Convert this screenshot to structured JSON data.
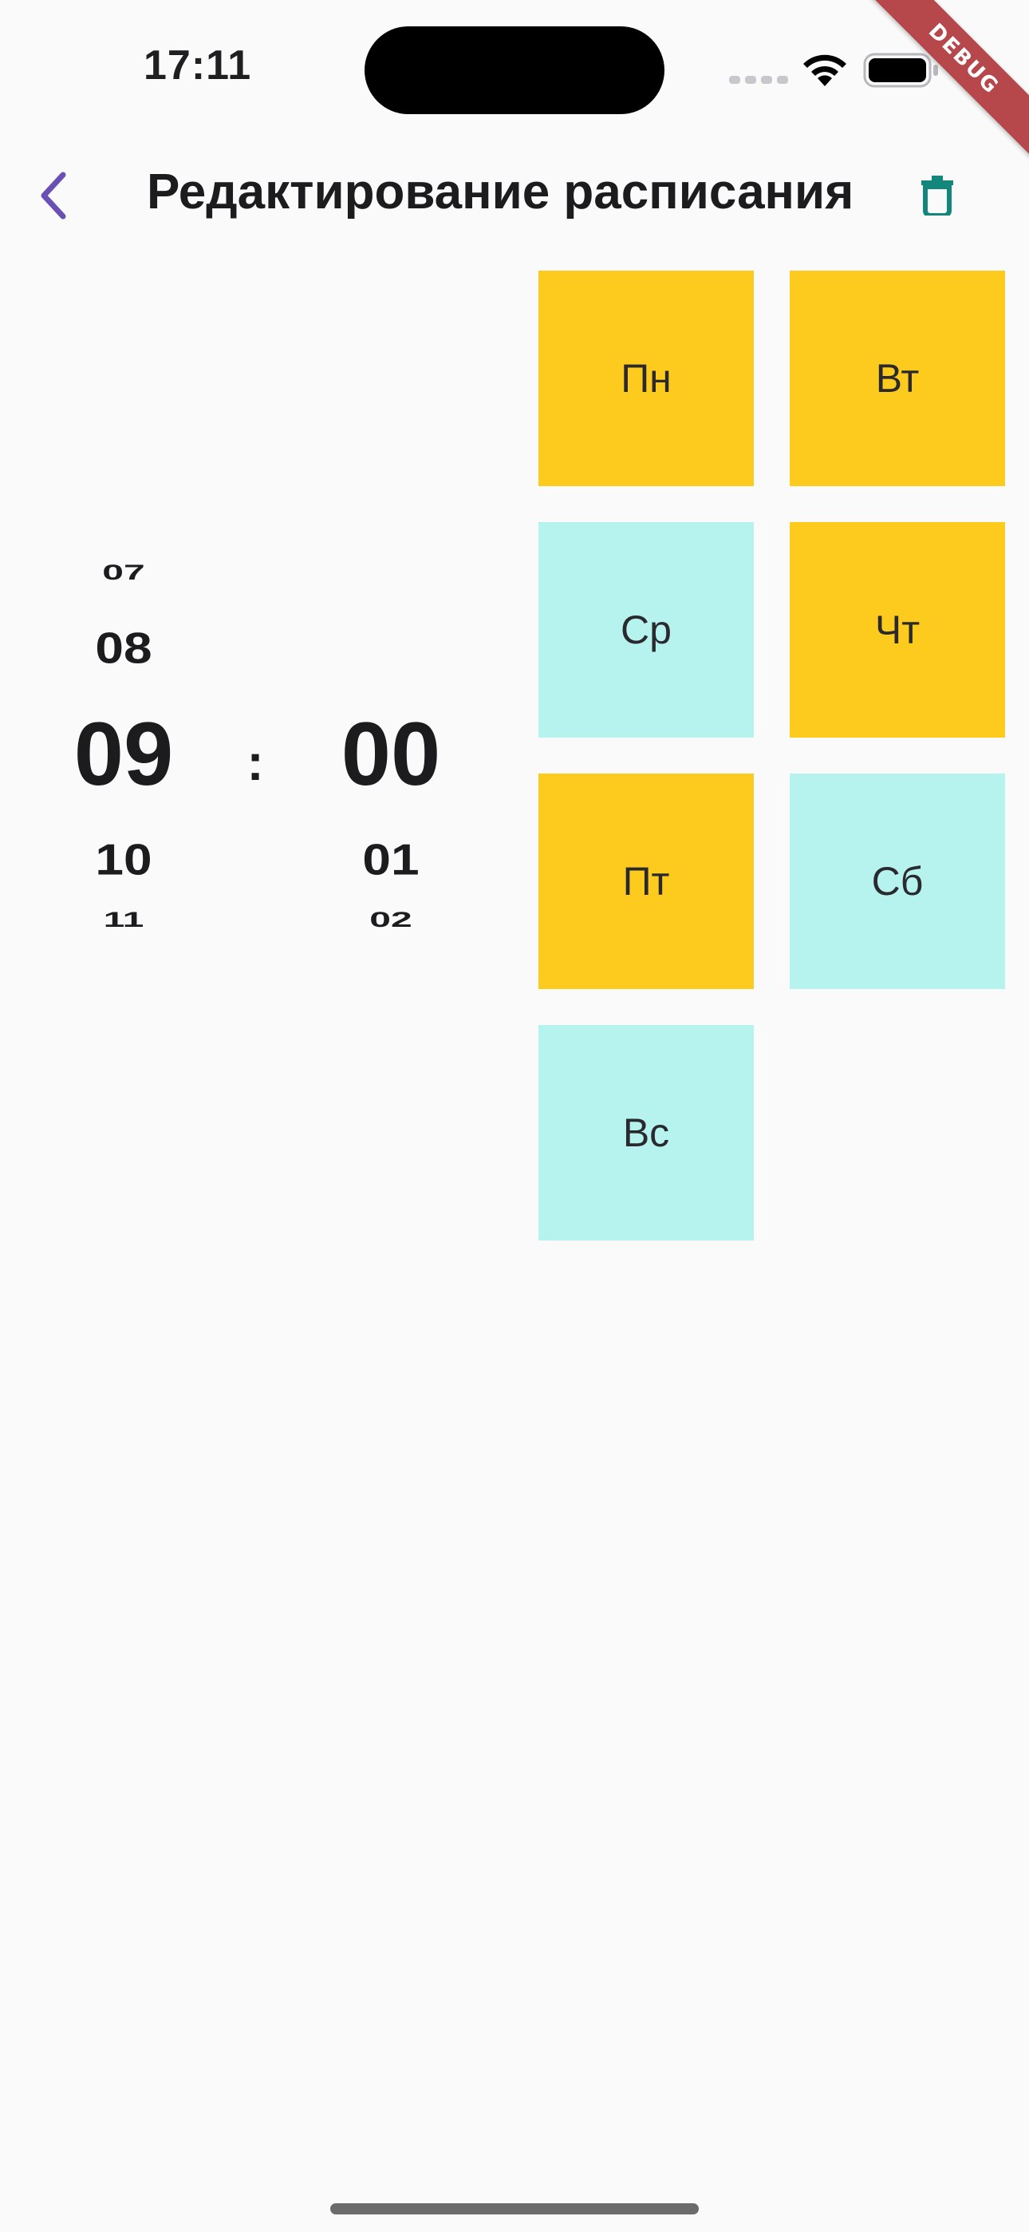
{
  "status_bar": {
    "time": "17:11"
  },
  "debug_banner": "DEBUG",
  "app_bar": {
    "title": "Редактирование расписания",
    "back_icon": "chevron-left-icon",
    "delete_icon": "trash-icon"
  },
  "time_picker": {
    "hours": [
      "07",
      "08",
      "09",
      "10",
      "11"
    ],
    "selected_hour": "09",
    "separator": ":",
    "minutes": [
      "",
      "",
      "00",
      "01",
      "02"
    ],
    "selected_minute": "00"
  },
  "days": [
    {
      "label": "Пн",
      "selected": true
    },
    {
      "label": "Вт",
      "selected": true
    },
    {
      "label": "Ср",
      "selected": false
    },
    {
      "label": "Чт",
      "selected": true
    },
    {
      "label": "Пт",
      "selected": true
    },
    {
      "label": "Сб",
      "selected": false
    },
    {
      "label": "Вс",
      "selected": false
    }
  ],
  "colors": {
    "selected_day": "#fccb1e",
    "unselected_day": "#b6f2ee",
    "accent_back": "#6a4fb5",
    "accent_delete": "#13877b",
    "background": "#fafafa",
    "debug_banner": "#b6474b"
  }
}
